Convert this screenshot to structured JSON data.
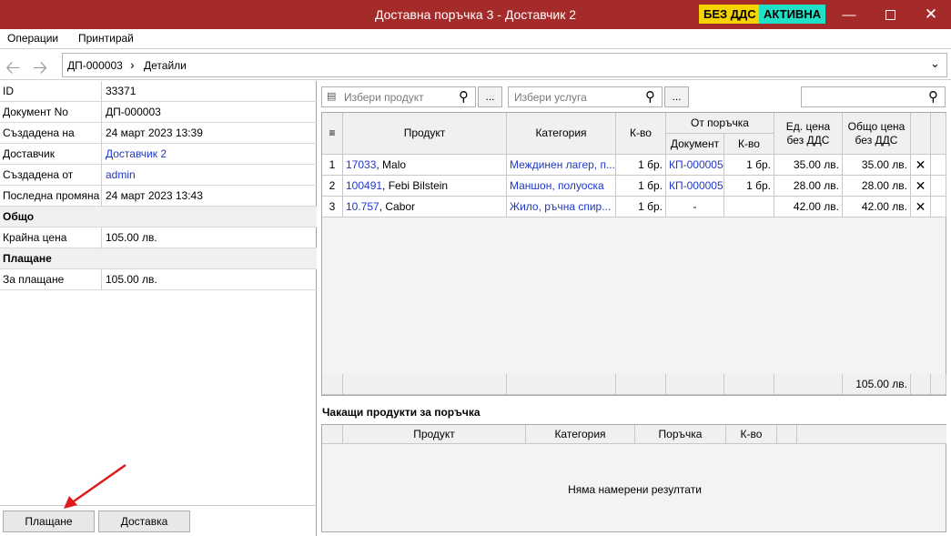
{
  "window": {
    "title": "Доставна поръчка 3 - Доставчик 2",
    "badge_vat": "БЕЗ ДДС",
    "badge_status": "АКТИВНА",
    "colors": {
      "titlebar": "#a52a2a",
      "badge_vat": "#f5d200",
      "badge_status": "#21e0c8"
    }
  },
  "menu": {
    "items": [
      "Операции",
      "Принтирай"
    ]
  },
  "nav": {
    "crumb_doc": "ДП-000003",
    "crumb_sep": "›",
    "crumb_page": "Детайли"
  },
  "details": {
    "rows": [
      {
        "label": "ID",
        "value": "33371"
      },
      {
        "label": "Документ No",
        "value": "ДП-000003"
      },
      {
        "label": "Създадена на",
        "value": "24 март 2023 13:39"
      },
      {
        "label": "Доставчик",
        "value": "Доставчик 2"
      },
      {
        "label": "Създадена от",
        "value": "admin"
      },
      {
        "label": "Последна промяна",
        "value": "24 март 2023 13:43"
      }
    ],
    "section_total": "Общо",
    "total_label": "Крайна цена",
    "total_value": "105.00 лв.",
    "section_payment": "Плащане",
    "payment_label": "За плащане",
    "payment_value": "105.00 лв."
  },
  "bottom_buttons": {
    "payment": "Плащане",
    "delivery": "Доставка"
  },
  "toolbar": {
    "product_placeholder": "Избери продукт",
    "service_placeholder": "Избери услуга",
    "more": "..."
  },
  "items_table": {
    "headers": {
      "product": "Продукт",
      "category": "Категория",
      "qty": "К-во",
      "from_order": "От поръчка",
      "document": "Документ",
      "order_qty": "К-во",
      "unit_price": "Ед. цена без ДДС",
      "total_price": "Общо цена без ДДС"
    },
    "rows": [
      {
        "n": "1",
        "code": "17033",
        "name": ", Malo",
        "category": "Междинен лагер, п...",
        "qty": "1 бр.",
        "doc": "КП-000005",
        "order_qty": "1 бр.",
        "unit": "35.00 лв.",
        "total": "35.00 лв."
      },
      {
        "n": "2",
        "code": "100491",
        "name": ", Febi Bilstein",
        "category": "Маншон, полуоска",
        "qty": "1 бр.",
        "doc": "КП-000005",
        "order_qty": "1 бр.",
        "unit": "28.00 лв.",
        "total": "28.00 лв."
      },
      {
        "n": "3",
        "code": "10.757",
        "name": ", Cabor",
        "category": "Жило, ръчна спир...",
        "qty": "1 бр.",
        "doc": "-",
        "order_qty": "",
        "unit": "42.00 лв.",
        "total": "42.00 лв."
      }
    ],
    "footer_total": "105.00 лв."
  },
  "pending": {
    "title": "Чакащи продукти за поръчка",
    "headers": {
      "product": "Продукт",
      "category": "Категория",
      "order": "Поръчка",
      "qty": "К-во"
    },
    "empty": "Няма намерени резултати"
  }
}
